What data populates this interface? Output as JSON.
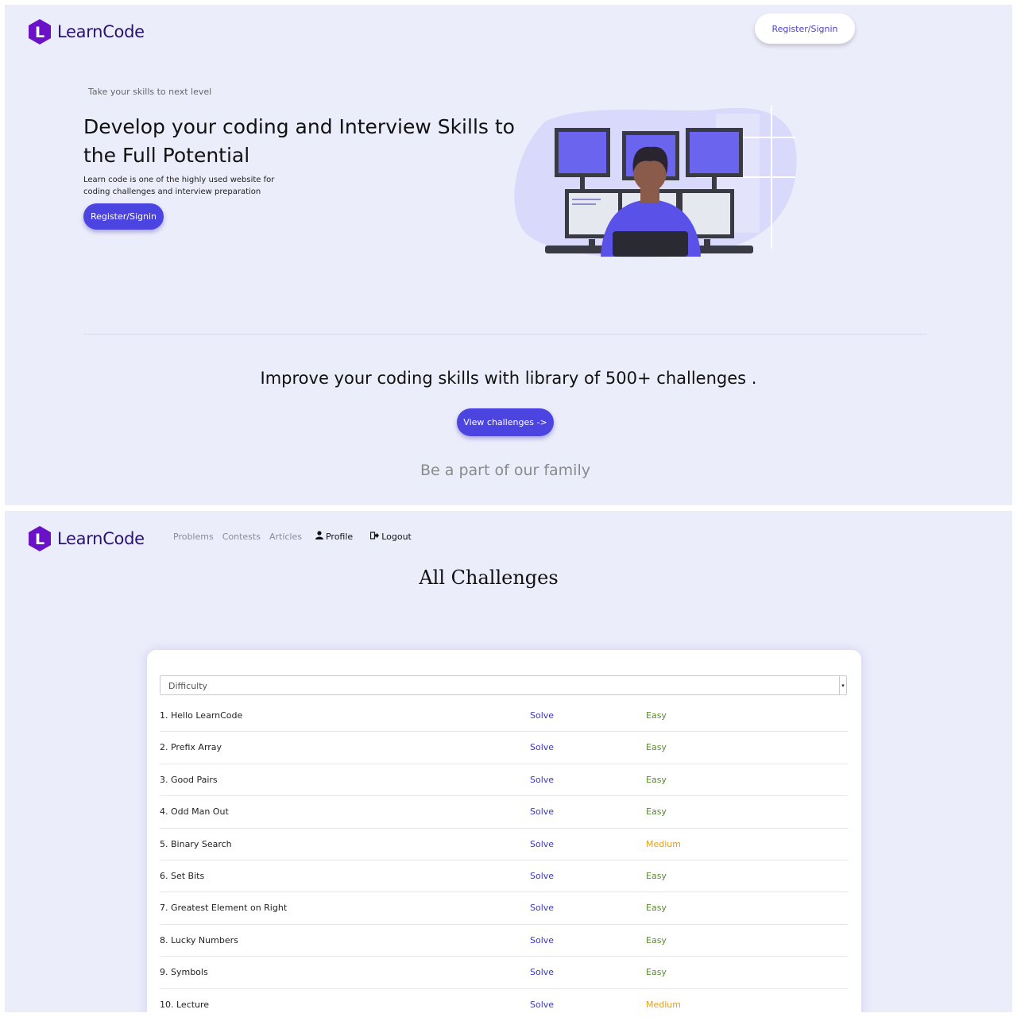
{
  "brand": {
    "name": "LearnCode",
    "letter": "L",
    "color": "#6b12c8"
  },
  "landing": {
    "header": {
      "register_label": "Register/Signin"
    },
    "hero": {
      "tagline": "Take your skills to next level",
      "title": "Develop your coding and Interview Skills to the Full Potential",
      "description": "Learn code is one of the highly used website for coding challenges and interview preparation",
      "cta_label": "Register/Signin",
      "illustration": "developer-at-monitors-illustration"
    },
    "improve_text": "Improve your coding skills with library of 500+ challenges .",
    "view_challenges_label": "View challenges ->",
    "family_text": "Be a part of our family"
  },
  "challenges_page": {
    "nav": {
      "problems": "Problems",
      "contests": "Contests",
      "articles": "Articles",
      "profile": "Profile",
      "logout": "Logout"
    },
    "title": "All Challenges",
    "filter": {
      "selected": "Difficulty"
    },
    "solve_label": "Solve",
    "challenges": [
      {
        "name": "1. Hello LearnCode",
        "difficulty": "Easy"
      },
      {
        "name": "2. Prefix Array",
        "difficulty": "Easy"
      },
      {
        "name": "3. Good Pairs",
        "difficulty": "Easy"
      },
      {
        "name": "4. Odd Man Out",
        "difficulty": "Easy"
      },
      {
        "name": "5. Binary Search",
        "difficulty": "Medium"
      },
      {
        "name": "6. Set Bits",
        "difficulty": "Easy"
      },
      {
        "name": "7. Greatest Element on Right",
        "difficulty": "Easy"
      },
      {
        "name": "8. Lucky Numbers",
        "difficulty": "Easy"
      },
      {
        "name": "9. Symbols",
        "difficulty": "Easy"
      },
      {
        "name": "10. Lecture",
        "difficulty": "Medium"
      }
    ]
  },
  "colors": {
    "background": "#ecedfb",
    "primary": "#4c44e0",
    "easy": "#5a8a2e",
    "medium": "#e0a020",
    "solve": "#3a36c8"
  }
}
